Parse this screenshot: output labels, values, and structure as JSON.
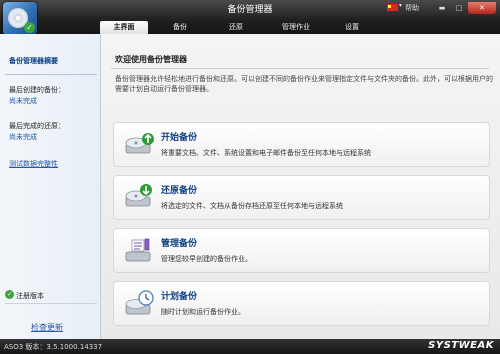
{
  "window": {
    "title": "备份管理器",
    "help": "帮助"
  },
  "tabs": [
    "主界面",
    "备份",
    "还原",
    "管理作业",
    "设置"
  ],
  "sidebar": {
    "heading": "备份管理器摘要",
    "last_backup_label": "最后创建的备份：",
    "last_backup_value": "尚未完成",
    "last_restore_label": "最后完成的还原：",
    "last_restore_value": "尚未完成",
    "test_link": "测试数据完整性",
    "registered": "注册版本",
    "check_updates": "检查更新"
  },
  "main": {
    "title": "欢迎使用备份管理器",
    "intro": "备份管理器允许轻松地进行备份和还原。可以创建不同的备份作业来管理指定文件与文件夹的备份。此外，可以根据用户的需要计划自动运行备份管理器。",
    "cards": [
      {
        "title": "开始备份",
        "desc": "将重要文档、文件、系统设置和电子邮件备份至任何本地与远程系统",
        "icon": "start-backup-icon"
      },
      {
        "title": "还原备份",
        "desc": "将选定的文件、文档从备份存档还原至任何本地与远程系统",
        "icon": "restore-backup-icon"
      },
      {
        "title": "管理备份",
        "desc": "管理您较早创建的备份作业。",
        "icon": "manage-backup-icon"
      },
      {
        "title": "计划备份",
        "desc": "随时计划和运行备份作业。",
        "icon": "schedule-backup-icon"
      }
    ]
  },
  "status": {
    "version": "ASO3 版本：3.5.1000.14337",
    "brand": "SYSTWEAK"
  }
}
